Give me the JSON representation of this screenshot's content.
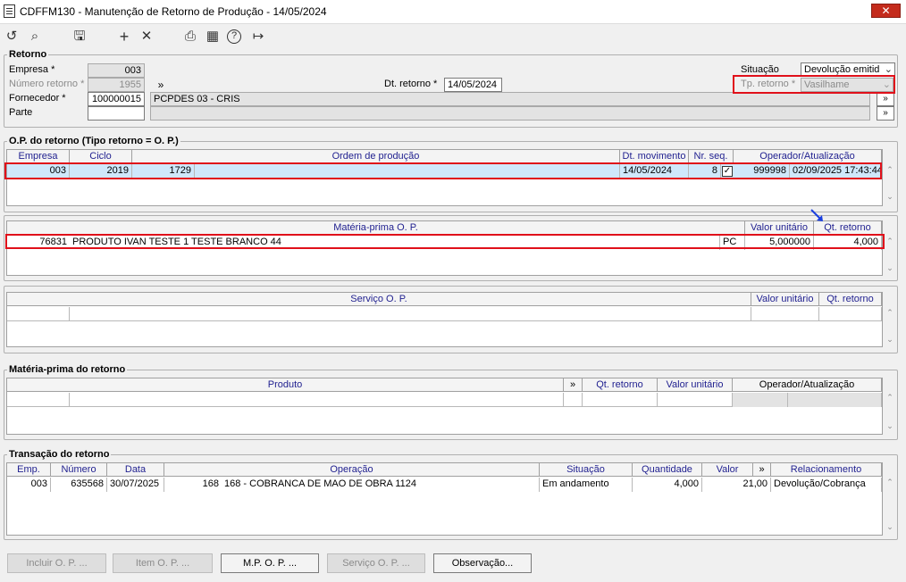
{
  "window": {
    "title": "CDFFM130 - Manutenção de Retorno de Produção - 14/05/2024",
    "close": "✕"
  },
  "toolbar": {
    "icons": [
      "undo-icon",
      "search-icon",
      "save-icon",
      "add-icon",
      "delete-icon",
      "print-icon",
      "calendar-icon",
      "help-icon",
      "exit-icon"
    ],
    "glyphs": {
      "undo": "↺",
      "search": "⌕",
      "save": "🖫",
      "add": "+",
      "delete": "✕",
      "print": "⎙",
      "calendar": "▦",
      "help": "?",
      "exit": "↦"
    }
  },
  "retorno": {
    "title": "Retorno",
    "empresa_label": "Empresa *",
    "empresa": "003",
    "numero_label": "Número retorno *",
    "numero": "1955",
    "fornecedor_label": "Fornecedor *",
    "fornecedor": "100000015",
    "fornecedor_nome": "PCPDES 03 - CRIS",
    "parte_label": "Parte",
    "parte": "",
    "dt_label": "Dt. retorno *",
    "dt": "14/05/2024",
    "situacao_label": "Situação",
    "situacao": "Devolução emitid",
    "tp_label": "Tp. retorno *",
    "tp": "Vasilhame",
    "more": "»"
  },
  "op": {
    "title": "O.P. do retorno (Tipo retorno = O. P.)",
    "headers": [
      "Empresa",
      "Ciclo",
      "Ordem de produção",
      "Dt. movimento",
      "Nr. seq.",
      "Operador/Atualização"
    ],
    "row": {
      "empresa": "003",
      "ciclo": "2019",
      "ordem": "1729",
      "dt": "14/05/2024",
      "seq": "8",
      "check": "✓",
      "operador": "999998",
      "atualizacao": "02/09/2025 17:43:44"
    }
  },
  "mp_op": {
    "headers": [
      "Matéria-prima O. P.",
      "Valor unitário",
      "Qt. retorno"
    ],
    "row": {
      "codigo": "76831",
      "descricao": "PRODUTO IVAN TESTE 1 TESTE BRANCO 44",
      "un": "PC",
      "valor": "5,000000",
      "qt": "4,000"
    }
  },
  "servico": {
    "headers": [
      "Serviço O. P.",
      "Valor unitário",
      "Qt. retorno"
    ]
  },
  "mp_retorno": {
    "title": "Matéria-prima do retorno",
    "headers": [
      "Produto",
      "»",
      "Qt. retorno",
      "Valor unitário",
      "Operador/Atualização"
    ]
  },
  "transacao": {
    "title": "Transação do retorno",
    "headers": [
      "Emp.",
      "Número",
      "Data",
      "Operação",
      "Situação",
      "Quantidade",
      "Valor",
      "»",
      "Relacionamento"
    ],
    "row": {
      "emp": "003",
      "numero": "635568",
      "data": "30/07/2025",
      "op_cod": "168",
      "op_desc": "168 - COBRANCA DE MAO DE OBRA 1124",
      "situacao": "Em andamento",
      "quantidade": "4,000",
      "valor": "21,00",
      "relacionamento": "Devolução/Cobrança"
    }
  },
  "buttons": {
    "incluir": "Incluir O. P. ...",
    "item": "Item O. P. ...",
    "mp": "M.P. O. P. ...",
    "servico": "Serviço O. P. ...",
    "obs": "Observação..."
  },
  "scroll": {
    "up": "⌃",
    "down": "⌄"
  }
}
